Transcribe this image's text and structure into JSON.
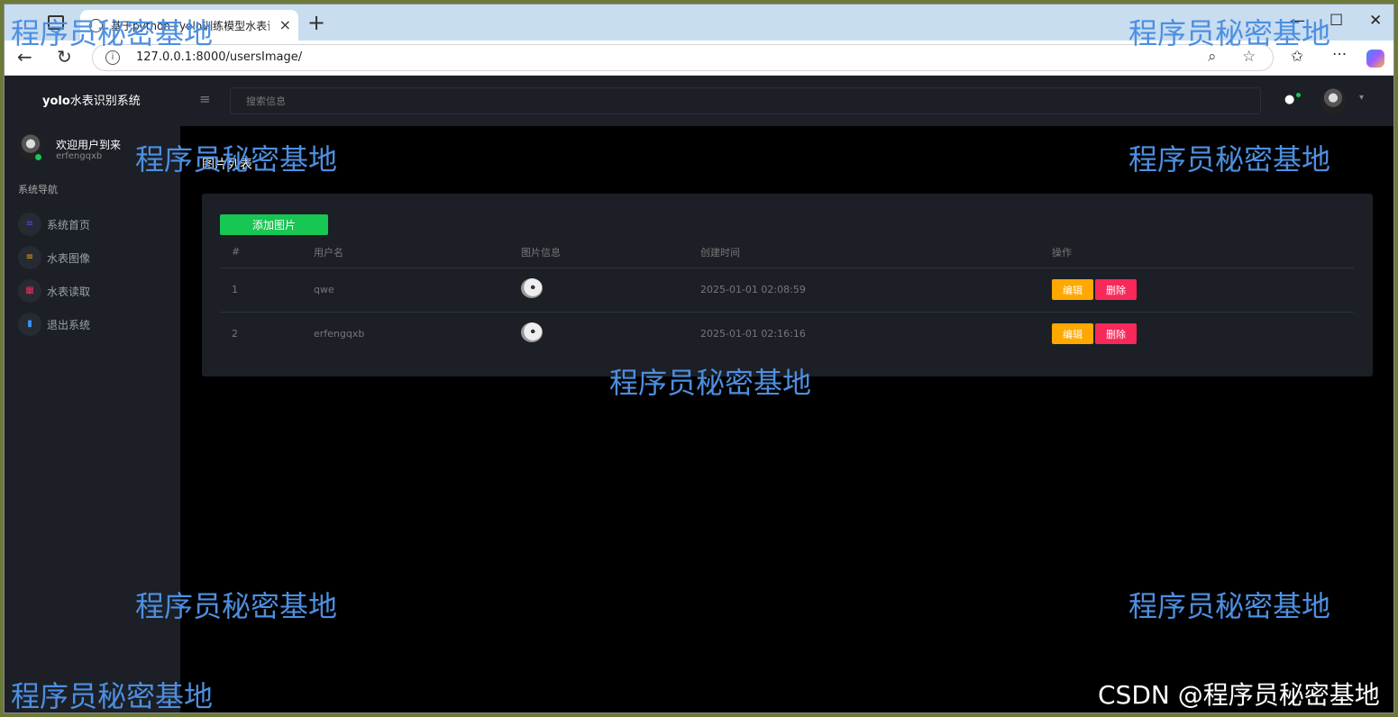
{
  "browser": {
    "tab_title": "基于python+yolo训练模型水表识",
    "tab_close": "×",
    "new_tab": "+",
    "url": "127.0.0.1:8000/usersImage/",
    "window_controls": [
      "—",
      "☐",
      "✕"
    ]
  },
  "app": {
    "brand_bold": "yolo",
    "brand_rest": "水表识别系统",
    "menu_toggle": "≡",
    "search_placeholder": "搜索信息",
    "bell": "🔔"
  },
  "sidebar": {
    "welcome": "欢迎用户到来",
    "username": "erfengqxb",
    "heading": "系统导航",
    "items": [
      {
        "label": "系统首页",
        "icon": "menu-icon",
        "glyph": "≡",
        "color": "#7239ea"
      },
      {
        "label": "水表图像",
        "icon": "menu-icon",
        "glyph": "≡",
        "color": "#ffa800"
      },
      {
        "label": "水表读取",
        "icon": "grid-icon",
        "glyph": "▦",
        "color": "#f8285a"
      },
      {
        "label": "退出系统",
        "icon": "chart-icon",
        "glyph": "▮",
        "color": "#3e97ff"
      }
    ]
  },
  "main": {
    "page_title": "图片列表",
    "breadcrumb": "",
    "add_button": "添加图片",
    "table": {
      "headers": [
        "#",
        "用户名",
        "图片信息",
        "创建时间",
        "操作"
      ],
      "rows": [
        {
          "id": "1",
          "user": "qwe",
          "created": "2025-01-01 02:08:59"
        },
        {
          "id": "2",
          "user": "erfengqxb",
          "created": "2025-01-01 02:16:16"
        }
      ],
      "edit_label": "编辑",
      "delete_label": "删除"
    }
  },
  "watermark": "程序员秘密基地",
  "csdn_mark": "CSDN @程序员秘密基地",
  "colors": {
    "accent_green": "#17c653",
    "edit": "#ffa800",
    "delete": "#f8285a",
    "panel": "#1c1f26"
  }
}
